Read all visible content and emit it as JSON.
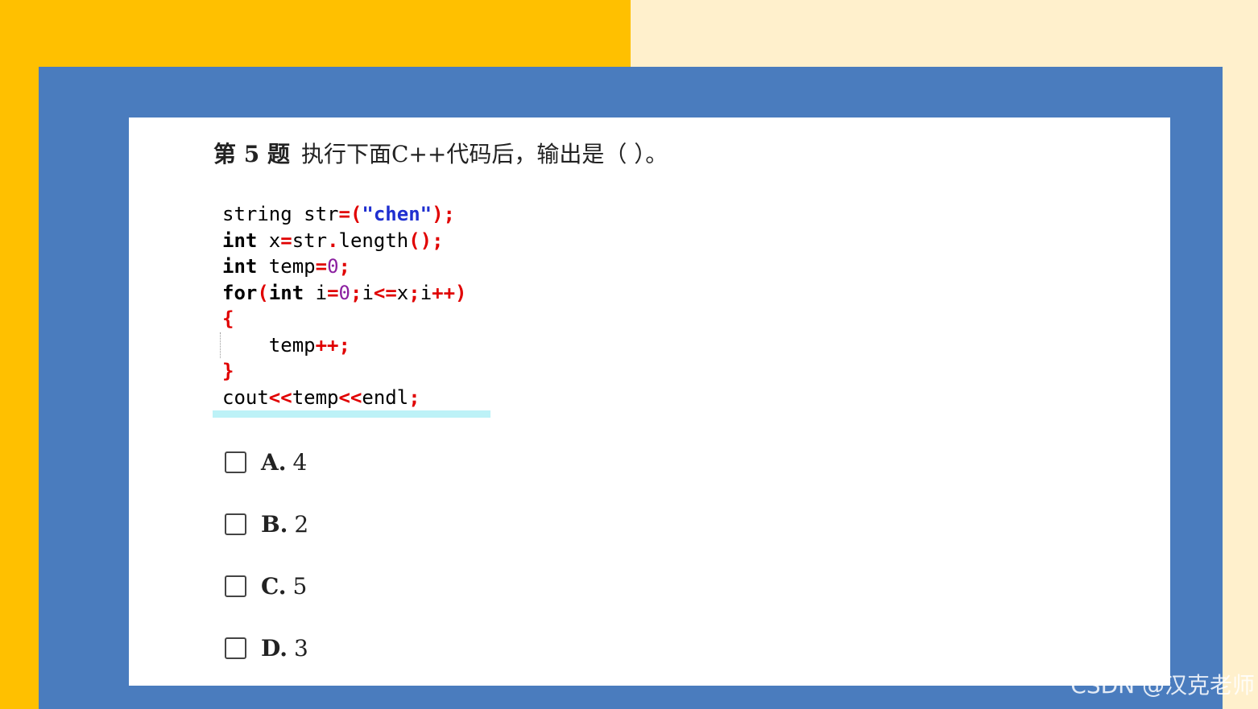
{
  "question": {
    "number_label": "第 5 题",
    "text": "执行下面C++代码后，输出是（        ）。"
  },
  "code": {
    "line1": {
      "t1": "string str",
      "t2": "=(",
      "t3": "\"chen\"",
      "t4": ");"
    },
    "line2": {
      "kw": "int",
      "t1": " x",
      "t2": "=",
      "t3": "str",
      "t4": ".",
      "t5": "length",
      "t6": "();"
    },
    "line3": {
      "kw": "int",
      "t1": " temp",
      "t2": "=",
      "t3": "0",
      "t4": ";"
    },
    "line4": {
      "kw": "for",
      "t1": "(",
      "kw2": "int",
      "t2": " i",
      "t3": "=",
      "t4": "0",
      "t5": ";",
      "t6": "i",
      "t7": "<=",
      "t8": "x",
      "t9": ";",
      "t10": "i",
      "t11": "++)"
    },
    "line5": {
      "t1": "{"
    },
    "line6": {
      "t1": "    temp",
      "t2": "++;"
    },
    "line7": {
      "t1": "}"
    },
    "line8": {
      "t1": "cout",
      "t2": "<<",
      "t3": "temp",
      "t4": "<<",
      "t5": "endl",
      "t6": ";"
    }
  },
  "options": [
    {
      "letter": "A.",
      "value": "4"
    },
    {
      "letter": "B.",
      "value": "2"
    },
    {
      "letter": "C.",
      "value": "5"
    },
    {
      "letter": "D.",
      "value": "3"
    }
  ],
  "watermark": "CSDN @汉克老师",
  "colors": {
    "left_bg": "#FFC000",
    "right_bg": "#FFF0CC",
    "panel": "#4A7CBE",
    "operator": "#E00000",
    "number": "#8B1FA0",
    "string": "#1F2FD0"
  }
}
